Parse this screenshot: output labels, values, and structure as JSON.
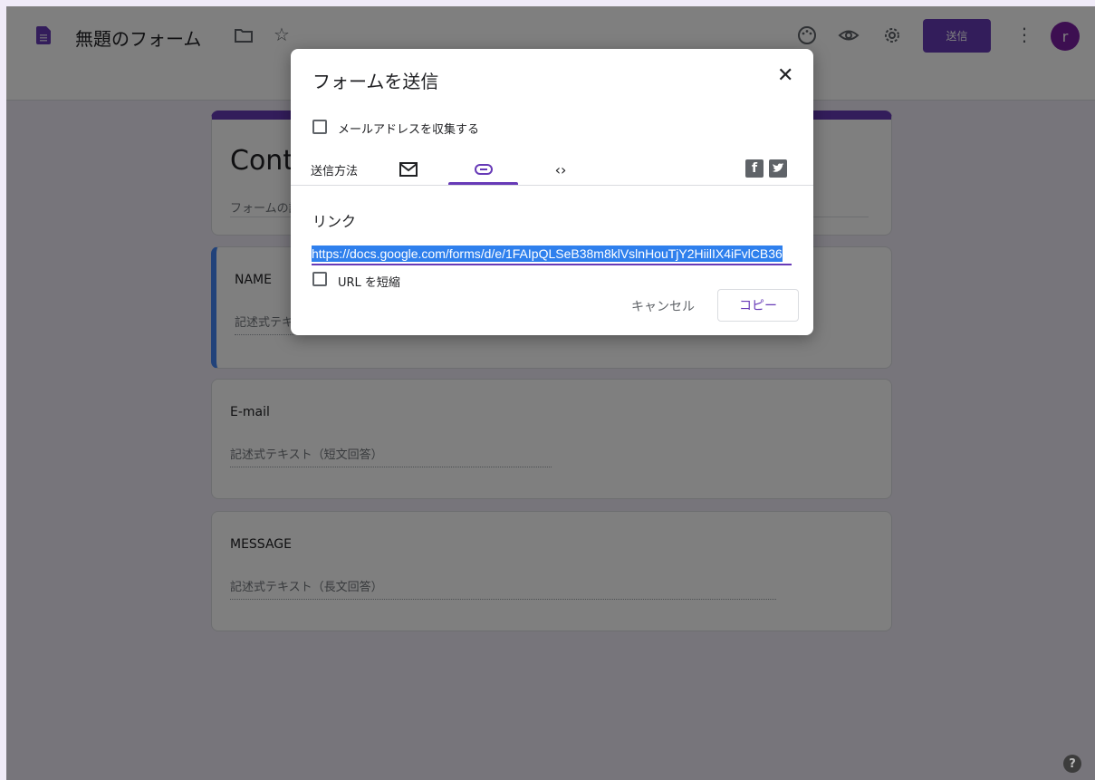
{
  "header": {
    "title": "無題のフォーム",
    "send_label": "送信",
    "avatar_letter": "r",
    "accent": "#673ab7"
  },
  "form": {
    "title": "Cont",
    "description": "フォームの説明",
    "questions": [
      {
        "label": "NAME",
        "hint": "記述式テキスト（短文回答）"
      },
      {
        "label": "E-mail",
        "hint": "記述式テキスト（短文回答）"
      },
      {
        "label": "MESSAGE",
        "hint": "記述式テキスト（長文回答）"
      }
    ]
  },
  "dialog": {
    "title": "フォームを送信",
    "collect_email_label": "メールアドレスを収集する",
    "send_via_label": "送信方法",
    "tabs": [
      {
        "icon": "mail-icon"
      },
      {
        "icon": "link-icon",
        "active": true
      },
      {
        "icon": "embed-icon"
      }
    ],
    "share": [
      "facebook-icon",
      "twitter-icon"
    ],
    "link_heading": "リンク",
    "url": "https://docs.google.com/forms/d/e/1FAIpQLSeB38m8klVslnHouTjY2HiilIX4iFvlCB36",
    "shorten_label": "URL を短縮",
    "cancel_label": "キャンセル",
    "copy_label": "コピー"
  },
  "help_label": "?"
}
